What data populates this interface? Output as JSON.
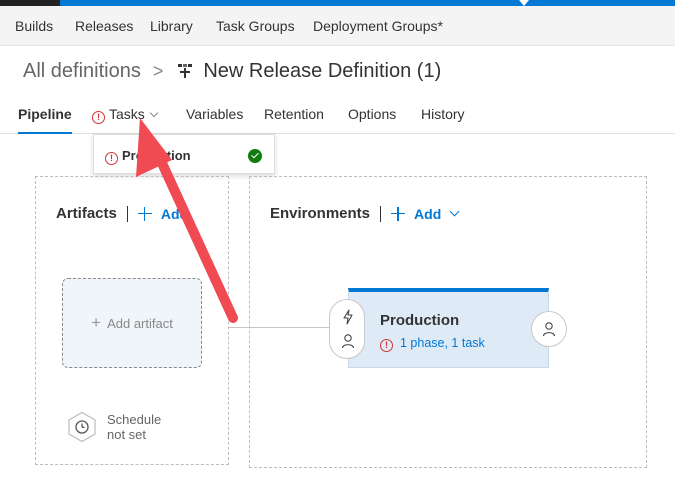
{
  "hub_nav": {
    "items": [
      "Builds",
      "Releases",
      "Library",
      "Task Groups",
      "Deployment Groups*"
    ]
  },
  "breadcrumb": {
    "root": "All definitions",
    "separator": ">",
    "title": "New Release Definition (1)",
    "icon": "release-definition-icon"
  },
  "tabs": {
    "pipeline": "Pipeline",
    "tasks": "Tasks",
    "variables": "Variables",
    "retention": "Retention",
    "options": "Options",
    "history": "History",
    "tasks_icon": "error-icon",
    "tasks_chevron": "chevron-down-icon"
  },
  "tasks_dropdown": {
    "item_label": "Production",
    "item_icon": "error-icon",
    "status_icon": "check-circle-icon"
  },
  "artifacts": {
    "heading": "Artifacts",
    "add_label": "Add",
    "add_artifact_label": "Add artifact",
    "schedule_line1": "Schedule",
    "schedule_line2": "not set",
    "schedule_icon": "clock-icon"
  },
  "environments": {
    "heading": "Environments",
    "add_label": "Add",
    "env_name": "Production",
    "env_status": "1 phase, 1 task",
    "pre_deploy_icons": [
      "trigger-icon",
      "person-icon"
    ],
    "post_deploy_icon": "person-icon"
  },
  "colors": {
    "accent": "#0078d4",
    "error": "#d13438",
    "success": "#107c10",
    "env_card_bg": "#deebf7",
    "annotation_arrow": "#f04a52"
  }
}
